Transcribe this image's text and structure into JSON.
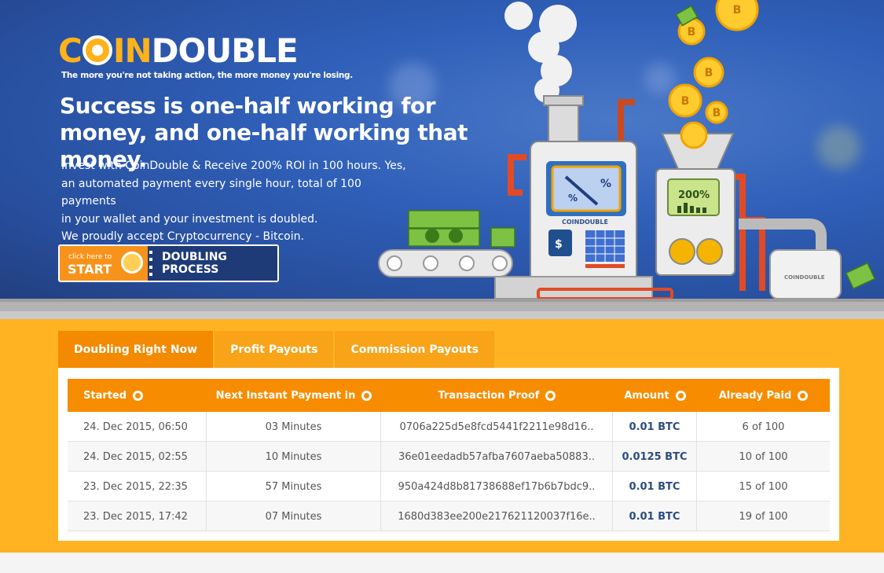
{
  "brand": {
    "logo_part_a": "C",
    "logo_part_b": "IN",
    "logo_part_c": "DOUBLE",
    "tagline": "The more you're not taking action, the more money you're losing."
  },
  "hero": {
    "headline": "Success is one-half working for money, and one-half working that money.",
    "lines": [
      "Invest with CoinDouble & Receive 200% ROI in 100 hours. Yes,",
      "an automated payment every single hour, total of 100 payments",
      "in your wallet and your investment is doubled.",
      "We proudly accept Cryptocurrency - Bitcoin."
    ],
    "cta_small": "click here to",
    "cta_start": "START",
    "cta_label": "DOUBLING PROCESS"
  },
  "machine": {
    "dial_label": "%",
    "screen_label": "200%",
    "brand_label": "COINDOUBLE",
    "dollar": "$",
    "bitcoin_symbol": "B"
  },
  "tabs": [
    {
      "label": "Doubling Right Now",
      "active": true
    },
    {
      "label": "Profit Payouts",
      "active": false
    },
    {
      "label": "Commission Payouts",
      "active": false
    }
  ],
  "table": {
    "headers": [
      "Started",
      "Next Instant Payment in",
      "Transaction Proof",
      "Amount",
      "Already Paid"
    ],
    "rows": [
      {
        "started": "24. Dec 2015, 06:50",
        "next": "03 Minutes",
        "proof": "0706a225d5e8fcd5441f2211e98d16..",
        "amount": "0.01 BTC",
        "paid": "6 of 100"
      },
      {
        "started": "24. Dec 2015, 02:55",
        "next": "10 Minutes",
        "proof": "36e01eedadb57afba7607aeba50883..",
        "amount": "0.0125 BTC",
        "paid": "10 of 100"
      },
      {
        "started": "23. Dec 2015, 22:35",
        "next": "57 Minutes",
        "proof": "950a424d8b81738688ef17b6b7bdc9..",
        "amount": "0.01 BTC",
        "paid": "15 of 100"
      },
      {
        "started": "23. Dec 2015, 17:42",
        "next": "07 Minutes",
        "proof": "1680d383ee200e217621120037f16e..",
        "amount": "0.01 BTC",
        "paid": "19 of 100"
      }
    ]
  },
  "colors": {
    "hero_blue": "#2f5fb8",
    "brand_orange": "#ffb21a",
    "section_orange": "#ffb322",
    "header_orange": "#f78c00",
    "navy": "#1e3b78"
  }
}
